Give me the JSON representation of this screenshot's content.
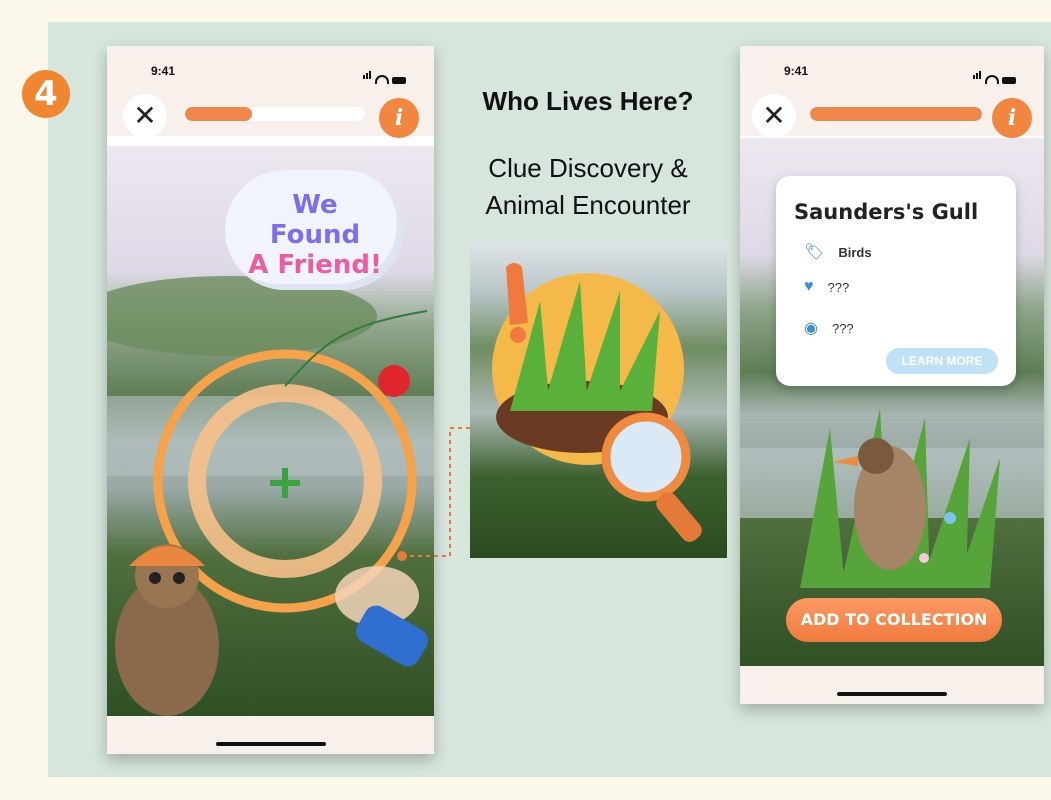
{
  "step": {
    "number": "4"
  },
  "left_phone": {
    "status_time": "9:41",
    "progress": 0.37,
    "close_icon": "close-icon",
    "info_icon": "info-icon",
    "speech_bubble": {
      "line1": "We Found",
      "line2": "A Friend!"
    }
  },
  "center": {
    "title": "Who Lives Here?",
    "subtitle_line1": "Clue Discovery &",
    "subtitle_line2": "Animal Encounter"
  },
  "right_phone": {
    "status_time": "9:41",
    "progress": 1.0,
    "card": {
      "title": "Saunders's Gull",
      "category": "Birds",
      "habitat": "???",
      "location": "???",
      "learn_more": "LEARN MORE"
    },
    "add_button": "ADD TO COLLECTION"
  },
  "colors": {
    "accent": "#f0862f",
    "panel": "#d6e6dc",
    "page": "#fbf7ea",
    "card_icon": "#3a8fd6"
  }
}
